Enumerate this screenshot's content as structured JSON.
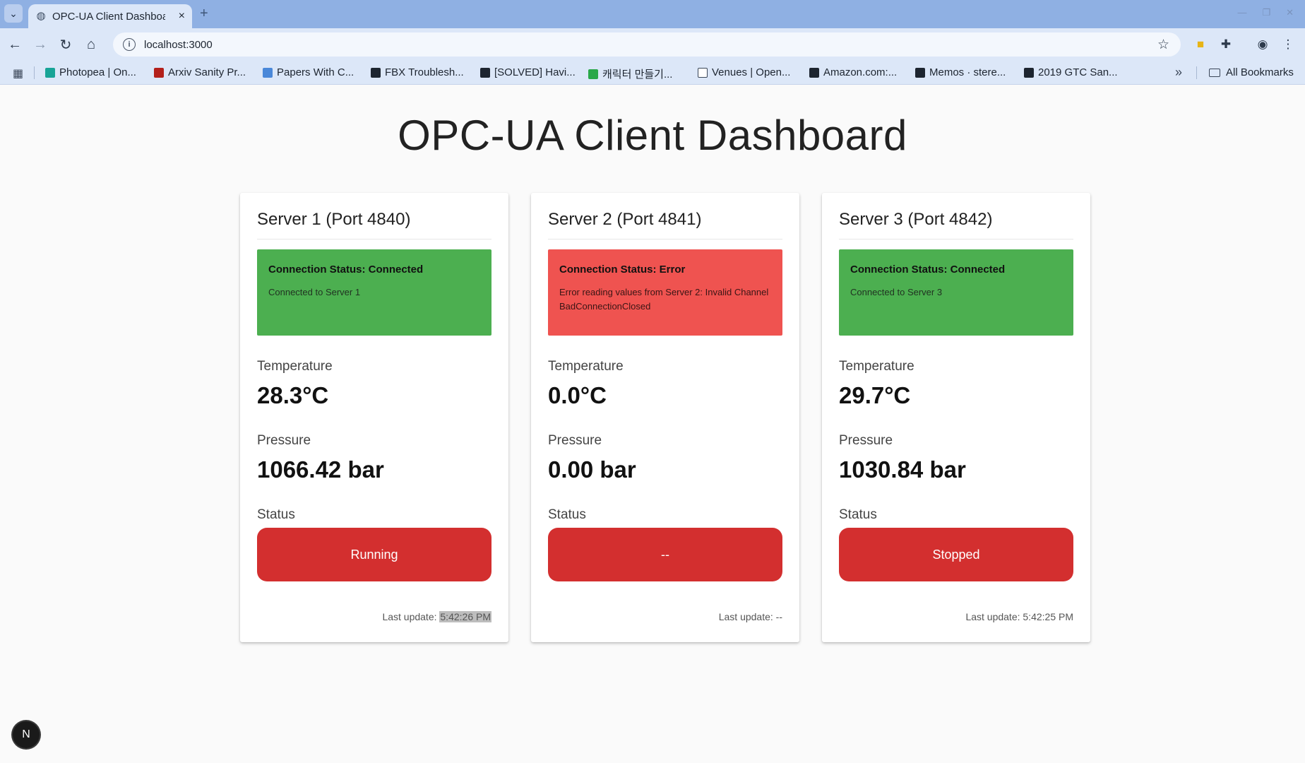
{
  "browser": {
    "tab_title": "OPC-UA Client Dashboard",
    "url": "localhost:3000",
    "bookmarks": [
      {
        "label": "Photopea | On...",
        "color": "#18a497"
      },
      {
        "label": "Arxiv Sanity Pr...",
        "color": "#b3201b"
      },
      {
        "label": "Papers With C...",
        "color": "#4a88d9"
      },
      {
        "label": "FBX Troublesh...",
        "color": "#1d2530"
      },
      {
        "label": "[SOLVED] Havi...",
        "color": "#1d2530"
      },
      {
        "label": "캐릭터 만들기...",
        "color": "#2aa84a"
      },
      {
        "label": "Venues | Open...",
        "color": "#ffffff"
      },
      {
        "label": "Amazon.com:...",
        "color": "#1d2530"
      },
      {
        "label": "Memos · stere...",
        "color": "#1d2530"
      },
      {
        "label": "2019 GTC San...",
        "color": "#1d2530"
      }
    ],
    "all_bookmarks": "All Bookmarks"
  },
  "page": {
    "title": "OPC-UA Client Dashboard"
  },
  "servers": [
    {
      "title": "Server 1 (Port 4840)",
      "connection_state": "ok",
      "connection_status": "Connection Status: Connected",
      "connection_message": "Connected to Server 1",
      "temperature_label": "Temperature",
      "temperature": "28.3°C",
      "pressure_label": "Pressure",
      "pressure": "1066.42 bar",
      "status_label": "Status",
      "status": "Running",
      "last_update_label": "Last update:",
      "last_update": "5:42:26 PM"
    },
    {
      "title": "Server 2 (Port 4841)",
      "connection_state": "err",
      "connection_status": "Connection Status: Error",
      "connection_message": "Error reading values from Server 2: Invalid Channel BadConnectionClosed",
      "temperature_label": "Temperature",
      "temperature": "0.0°C",
      "pressure_label": "Pressure",
      "pressure": "0.00 bar",
      "status_label": "Status",
      "status": "--",
      "last_update_label": "Last update:",
      "last_update": "--"
    },
    {
      "title": "Server 3 (Port 4842)",
      "connection_state": "ok",
      "connection_status": "Connection Status: Connected",
      "connection_message": "Connected to Server 3",
      "temperature_label": "Temperature",
      "temperature": "29.7°C",
      "pressure_label": "Pressure",
      "pressure": "1030.84 bar",
      "status_label": "Status",
      "status": "Stopped",
      "last_update_label": "Last update:",
      "last_update": "5:42:25 PM"
    }
  ],
  "dev_badge": "N",
  "colors": {
    "connected": "#4caf50",
    "error": "#ef5350",
    "status_button": "#d32f2f"
  }
}
